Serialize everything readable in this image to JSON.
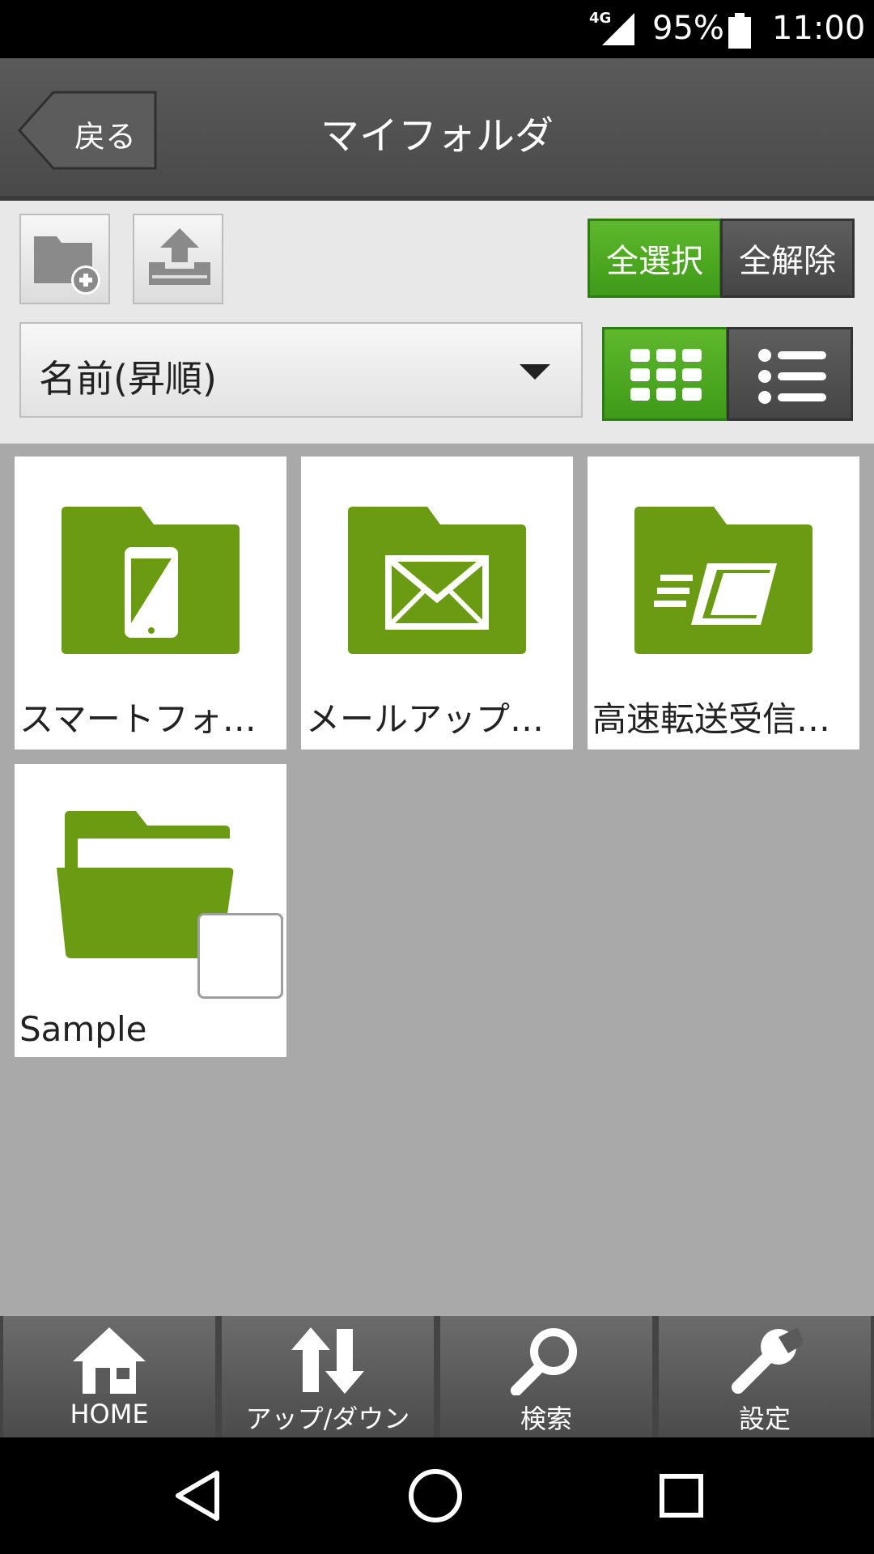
{
  "status": {
    "network": "4G",
    "battery": "95%",
    "time": "11:00"
  },
  "header": {
    "back_label": "戻る",
    "title": "マイフォルダ"
  },
  "toolbar": {
    "select_all": "全選択",
    "deselect_all": "全解除",
    "sort_value": "名前(昇順)"
  },
  "folders": [
    {
      "name": "スマートフォンデータ",
      "icon": "smartphone-folder-icon"
    },
    {
      "name": "メールアップロード",
      "icon": "mail-folder-icon"
    },
    {
      "name": "高速転送受信フォルダ",
      "icon": "transfer-folder-icon"
    },
    {
      "name": "Sample",
      "icon": "folder-open-icon"
    }
  ],
  "tabs": [
    {
      "label": "HOME",
      "icon": "home-icon"
    },
    {
      "label": "アップ/ダウン",
      "icon": "updown-arrows-icon"
    },
    {
      "label": "検索",
      "icon": "search-icon"
    },
    {
      "label": "設定",
      "icon": "wrench-icon"
    }
  ],
  "colors": {
    "accent_green": "#4aa71f",
    "folder_green": "#6b9b12"
  }
}
